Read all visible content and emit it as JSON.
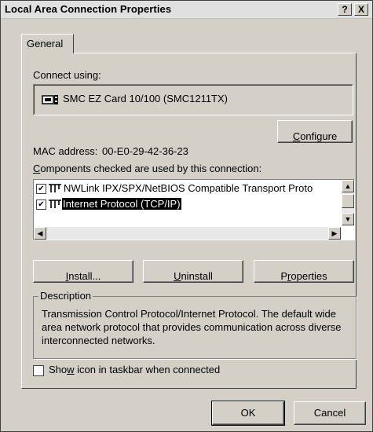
{
  "window": {
    "title": "Local Area Connection Properties",
    "help_label": "?",
    "close_label": "X"
  },
  "tabs": [
    {
      "label": "General",
      "selected": true
    }
  ],
  "connect_using": {
    "label": "Connect using:",
    "adapter_icon": "network-card-icon",
    "adapter_name": "SMC EZ Card 10/100 (SMC1211TX)"
  },
  "configure_button": {
    "underline": "C",
    "rest": "onfigure"
  },
  "mac_address": {
    "label": "MAC address:",
    "value": "00-E0-29-42-36-23"
  },
  "components": {
    "label_underline": "C",
    "label_rest": "omponents checked are used by this connection:",
    "items": [
      {
        "checked": true,
        "icon": "protocol-icon",
        "label": "NWLink IPX/SPX/NetBIOS Compatible Transport Proto",
        "selected": false
      },
      {
        "checked": true,
        "icon": "protocol-icon",
        "label": "Internet Protocol (TCP/IP)",
        "selected": true
      }
    ]
  },
  "action_buttons": {
    "install_underline": "I",
    "install_rest": "nstall...",
    "uninstall_underline": "U",
    "uninstall_rest": "ninstall",
    "properties_pre": "P",
    "properties_underline": "r",
    "properties_rest": "operties"
  },
  "description": {
    "legend": "Description",
    "text": "Transmission Control Protocol/Internet Protocol. The default wide area network protocol that provides communication across diverse interconnected networks."
  },
  "taskbar_option": {
    "checked": false,
    "label_pre": "Sho",
    "label_underline": "w",
    "label_rest": " icon in taskbar when connected"
  },
  "footer": {
    "ok_label": "OK",
    "cancel_label": "Cancel"
  }
}
